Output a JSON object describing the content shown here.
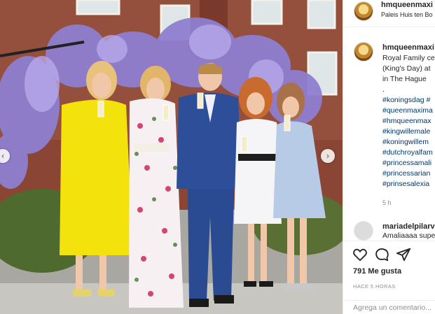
{
  "post": {
    "username": "hmqueenmaxi",
    "location": "Paleis Huis ten Bo",
    "caption_lines": [
      "Royal Family ce",
      "(King's Day) at",
      "in The Hague"
    ],
    "caption_dot": ".",
    "hashtags": [
      "#koningsdag #",
      "#queenmaxima",
      "#hmqueenmax",
      "#kingwillemale",
      "#koningwillem",
      "#dutchroyalfam",
      "#princessamali",
      "#princessarian",
      "#prinsesalexia"
    ],
    "caption_time": "5 h"
  },
  "comment": {
    "username": "mariadelpilarv",
    "text": "Amaliaaaa supe"
  },
  "actions": {
    "likes": "791 Me gusta",
    "time_ago": "HACE 5 HORAS",
    "comment_placeholder": "Agrega un comentario..."
  },
  "icons": {
    "like": "heart-icon",
    "comment": "comment-bubble-icon",
    "share": "paper-plane-icon",
    "prev": "chevron-left-icon",
    "next": "chevron-right-icon"
  },
  "nav": {
    "prev_glyph": "‹",
    "next_glyph": "›"
  },
  "colors": {
    "hashtag": "#00376b",
    "text": "#262626",
    "muted": "#8e8e8e"
  }
}
